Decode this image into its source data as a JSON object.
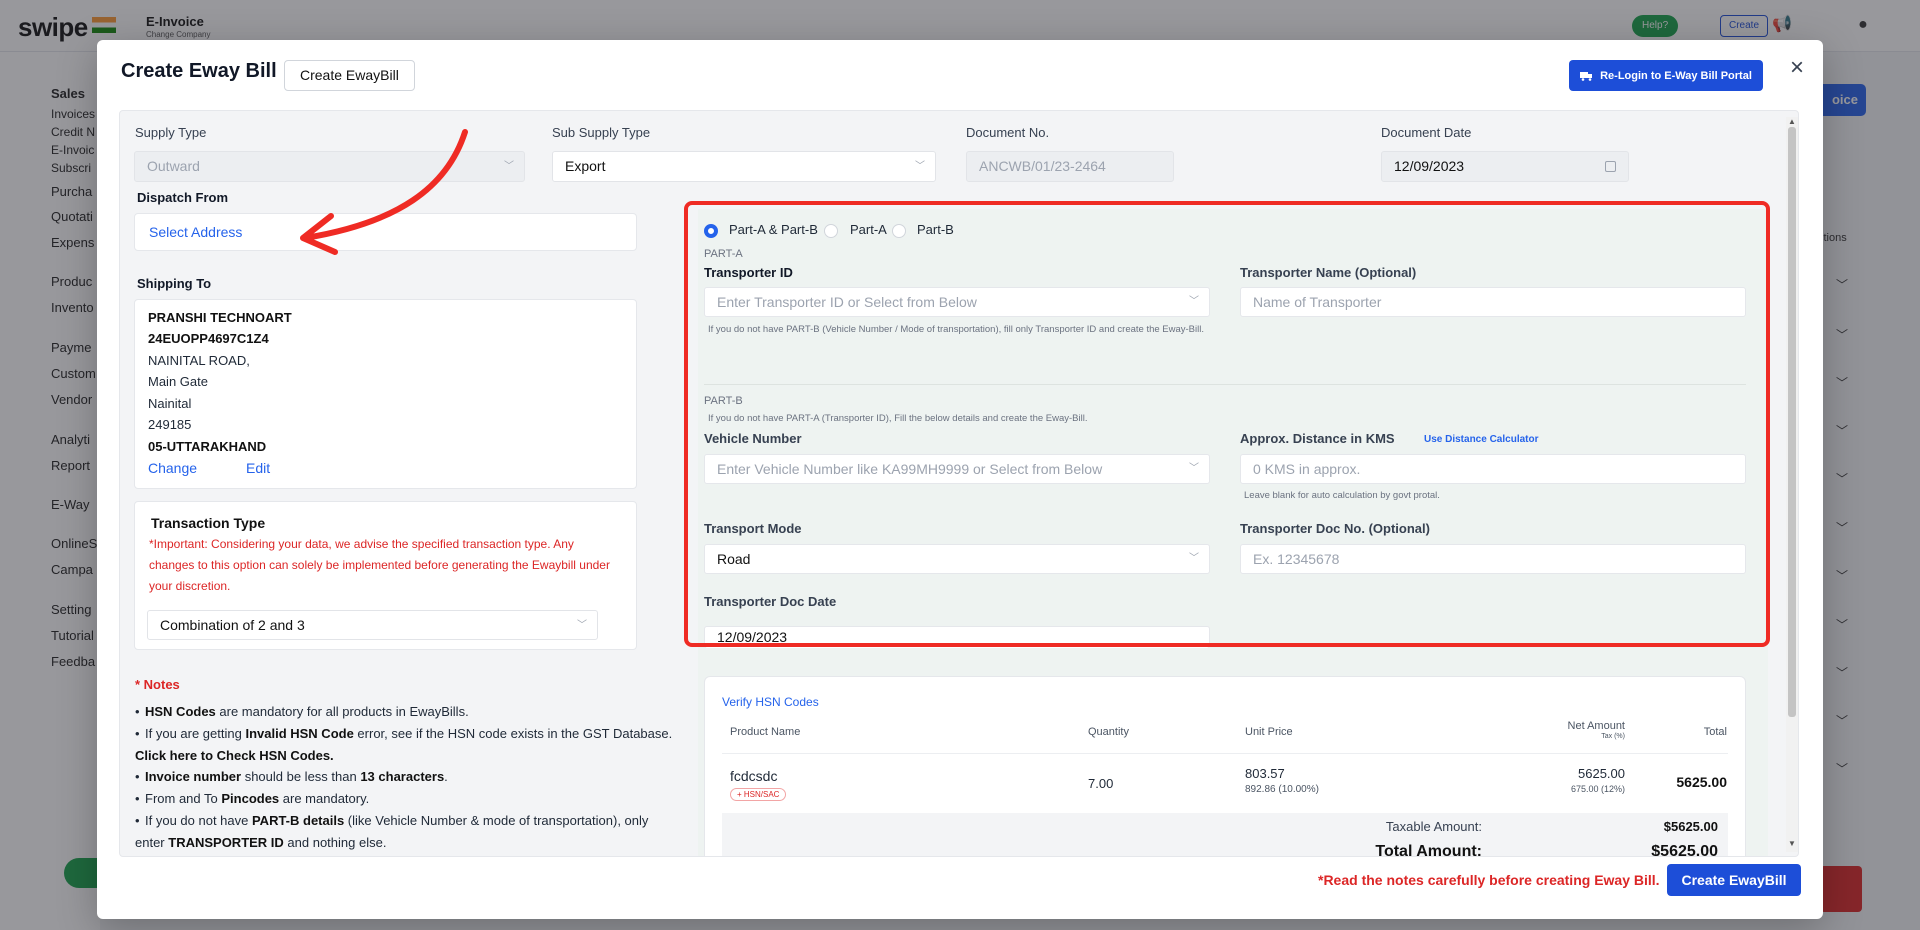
{
  "background": {
    "logo": "swipe",
    "company": "E-Invoice",
    "company_sub": "Change Company",
    "help": "Help?",
    "create": "Create",
    "right_button": "oice",
    "actions_header": "ctions",
    "sidebar": [
      {
        "label": "Sales",
        "style": "bold"
      },
      {
        "label": "Invoices",
        "style": "sub"
      },
      {
        "label": "Credit N",
        "style": "sub"
      },
      {
        "label": "E-Invoic",
        "style": "sub"
      },
      {
        "label": "Subscri",
        "style": "sub"
      },
      {
        "label": "Purcha",
        "style": "item"
      },
      {
        "label": "Quotati",
        "style": "item"
      },
      {
        "label": "Expens",
        "style": "item"
      },
      {
        "label": "Produc",
        "style": "item"
      },
      {
        "label": "Invento",
        "style": "item"
      },
      {
        "label": "Payme",
        "style": "item"
      },
      {
        "label": "Custom",
        "style": "item"
      },
      {
        "label": "Vendor",
        "style": "item"
      },
      {
        "label": "Analyti",
        "style": "item"
      },
      {
        "label": "Report",
        "style": "item"
      },
      {
        "label": "E-Way",
        "style": "item"
      },
      {
        "label": "OnlineS",
        "style": "item"
      },
      {
        "label": "Campa",
        "style": "item"
      },
      {
        "label": "Setting",
        "style": "item"
      },
      {
        "label": "Tutorial",
        "style": "item"
      },
      {
        "label": "Feedba",
        "style": "item"
      }
    ]
  },
  "modal": {
    "title": "Create Eway Bill",
    "create_button": "Create EwayBill",
    "relogin_button": "Re-Login to E-Way Bill Portal",
    "close": "×",
    "supply_type": {
      "label": "Supply Type",
      "value": "Outward"
    },
    "sub_supply_type": {
      "label": "Sub Supply Type",
      "value": "Export"
    },
    "document_no": {
      "label": "Document No.",
      "value": "ANCWB/01/23-2464"
    },
    "document_date": {
      "label": "Document Date",
      "value": "12/09/2023"
    },
    "dispatch_from": {
      "label": "Dispatch From",
      "button": "Select Address"
    },
    "shipping_to": {
      "label": "Shipping To",
      "lines": [
        "PRANSHI TECHNOART",
        "24EUOPP4697C1Z4",
        "NAINITAL ROAD,",
        "Main Gate",
        "Nainital",
        "249185",
        "05-UTTARAKHAND"
      ],
      "change": "Change",
      "edit": "Edit"
    },
    "transaction_type": {
      "label": "Transaction Type",
      "warning": "*Important: Considering your data, we advise the specified transaction type. Any changes to this option can solely be implemented before generating the Ewaybill under your discretion.",
      "value": "Combination of 2 and 3"
    },
    "notes": {
      "title": "* Notes",
      "items": [
        {
          "parts": [
            {
              "b": "HSN Codes"
            },
            {
              "t": " are mandatory for all products in EwayBills."
            }
          ]
        },
        {
          "parts": [
            {
              "t": "If you are getting "
            },
            {
              "b": "Invalid HSN Code"
            },
            {
              "t": " error, see if the HSN code exists in the GST Database. "
            },
            {
              "b": "Click here to Check HSN Codes."
            }
          ]
        },
        {
          "parts": [
            {
              "b": "Invoice number"
            },
            {
              "t": " should be less than "
            },
            {
              "b": "13 characters"
            },
            {
              "t": "."
            }
          ]
        },
        {
          "parts": [
            {
              "t": "From and To "
            },
            {
              "b": "Pincodes"
            },
            {
              "t": " are mandatory."
            }
          ]
        },
        {
          "parts": [
            {
              "t": "If you do not have "
            },
            {
              "b": "PART-B details"
            },
            {
              "t": " (like Vehicle Number & mode of transportation), only enter "
            },
            {
              "b": "TRANSPORTER ID"
            },
            {
              "t": " and nothing else."
            }
          ]
        }
      ]
    },
    "parts": {
      "options": [
        "Part-A & Part-B",
        "Part-A",
        "Part-B"
      ],
      "selected": "Part-A & Part-B",
      "part_a": {
        "heading": "PART-A",
        "transporter_id": {
          "label": "Transporter ID",
          "placeholder": "Enter Transporter ID or Select from Below",
          "help": "If you do not have PART-B (Vehicle Number / Mode of transportation), fill only Transporter ID and create the Eway-Bill."
        },
        "transporter_name": {
          "label": "Transporter Name (Optional)",
          "placeholder": "Name of Transporter"
        }
      },
      "part_b": {
        "heading": "PART-B",
        "help": "If you do not have PART-A (Transporter ID), Fill the below details and create the Eway-Bill.",
        "vehicle_number": {
          "label": "Vehicle Number",
          "placeholder": "Enter Vehicle Number like KA99MH9999 or Select from Below"
        },
        "distance": {
          "label": "Approx. Distance in KMS",
          "link": "Use Distance Calculator",
          "placeholder": "0 KMS in approx.",
          "help": "Leave blank for auto calculation by govt protal."
        },
        "transport_mode": {
          "label": "Transport Mode",
          "value": "Road"
        },
        "doc_no": {
          "label": "Transporter Doc No. (Optional)",
          "placeholder": "Ex. 12345678"
        },
        "doc_date": {
          "label": "Transporter Doc Date",
          "value": "12/09/2023"
        }
      }
    },
    "hsn": {
      "verify_link": "Verify HSN Codes",
      "headers": {
        "product": "Product Name",
        "quantity": "Quantity",
        "unit_price": "Unit Price",
        "net_amount": "Net Amount",
        "tax": "Tax (%)",
        "total": "Total"
      },
      "row": {
        "product": "fcdcsdc",
        "tag": "+ HSN/SAC",
        "quantity": "7.00",
        "unit_price": "803.57",
        "unit_price_sub": "892.86 (10.00%)",
        "net_amount": "5625.00",
        "net_amount_sub": "675.00 (12%)",
        "total": "5625.00"
      },
      "taxable_label": "Taxable Amount:",
      "taxable_value": "$5625.00",
      "total_label": "Total Amount:",
      "total_value": "$5625.00"
    },
    "footer_note": "*Read the notes carefully before creating Eway Bill.",
    "footer_button": "Create EwayBill"
  }
}
